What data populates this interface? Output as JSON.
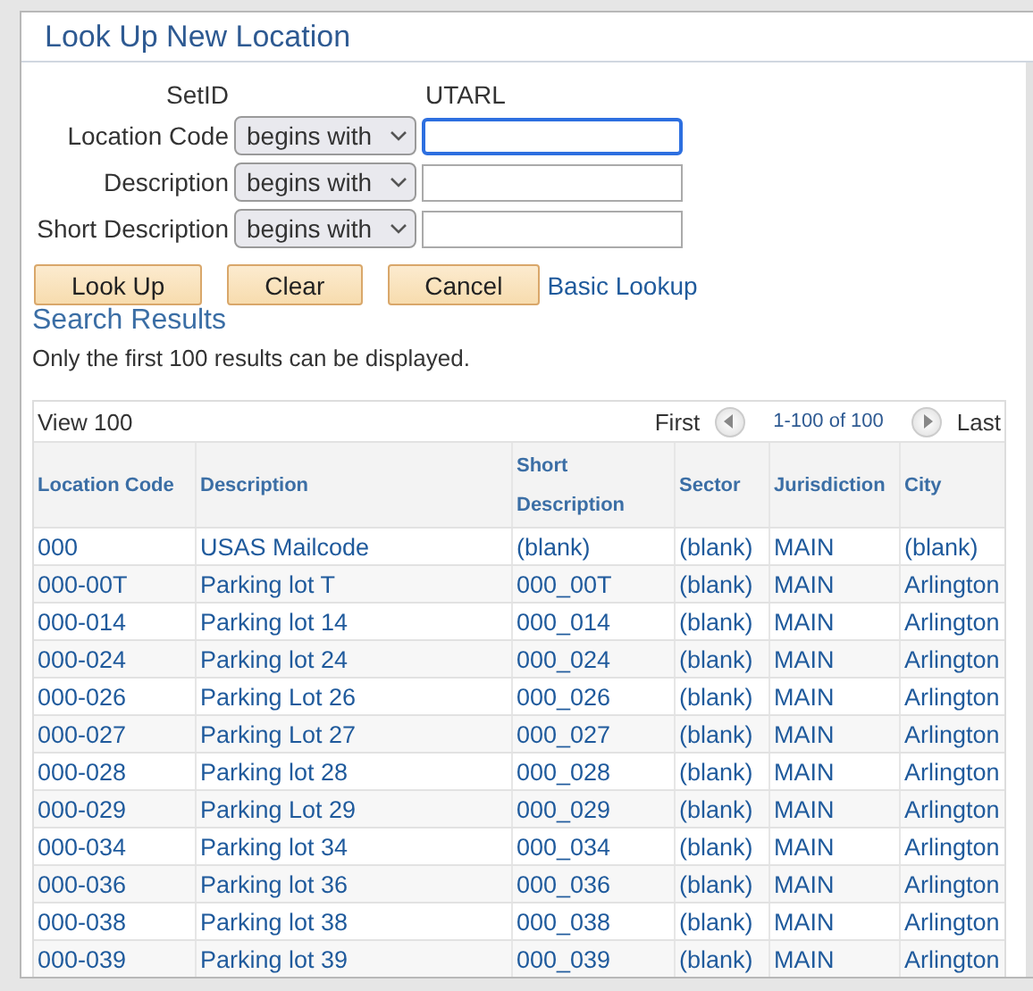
{
  "dialog": {
    "title": "Look Up New Location"
  },
  "criteria": {
    "setid_label": "SetID",
    "setid_value": "UTARL",
    "fields": [
      {
        "label": "Location Code",
        "operator": "begins with",
        "focused": true
      },
      {
        "label": "Description",
        "operator": "begins with",
        "focused": false
      },
      {
        "label": "Short Description",
        "operator": "begins with",
        "focused": false
      }
    ]
  },
  "buttons": [
    "Look Up",
    "Clear",
    "Cancel"
  ],
  "basic_lookup_link": "Basic Lookup",
  "results": {
    "title": "Search Results",
    "note": "Only the first 100 results can be displayed.",
    "view_all": "View 100",
    "first": "First",
    "range": "1-100 of 100",
    "last": "Last",
    "columns": [
      "Location Code",
      "Description",
      "Short Description",
      "Sector",
      "Jurisdiction",
      "City"
    ],
    "rows": [
      [
        "000",
        "USAS Mailcode",
        "(blank)",
        "(blank)",
        "MAIN",
        "(blank)"
      ],
      [
        "000-00T",
        "Parking lot T",
        "000_00T",
        "(blank)",
        "MAIN",
        "Arlington"
      ],
      [
        "000-014",
        "Parking lot 14",
        "000_014",
        "(blank)",
        "MAIN",
        "Arlington"
      ],
      [
        "000-024",
        "Parking lot 24",
        "000_024",
        "(blank)",
        "MAIN",
        "Arlington"
      ],
      [
        "000-026",
        "Parking Lot 26",
        "000_026",
        "(blank)",
        "MAIN",
        "Arlington"
      ],
      [
        "000-027",
        "Parking Lot 27",
        "000_027",
        "(blank)",
        "MAIN",
        "Arlington"
      ],
      [
        "000-028",
        "Parking lot 28",
        "000_028",
        "(blank)",
        "MAIN",
        "Arlington"
      ],
      [
        "000-029",
        "Parking Lot 29",
        "000_029",
        "(blank)",
        "MAIN",
        "Arlington"
      ],
      [
        "000-034",
        "Parking lot 34",
        "000_034",
        "(blank)",
        "MAIN",
        "Arlington"
      ],
      [
        "000-036",
        "Parking lot 36",
        "000_036",
        "(blank)",
        "MAIN",
        "Arlington"
      ],
      [
        "000-038",
        "Parking lot 38",
        "000_038",
        "(blank)",
        "MAIN",
        "Arlington"
      ],
      [
        "000-039",
        "Parking lot 39",
        "000_039",
        "(blank)",
        "MAIN",
        "Arlington"
      ]
    ]
  }
}
